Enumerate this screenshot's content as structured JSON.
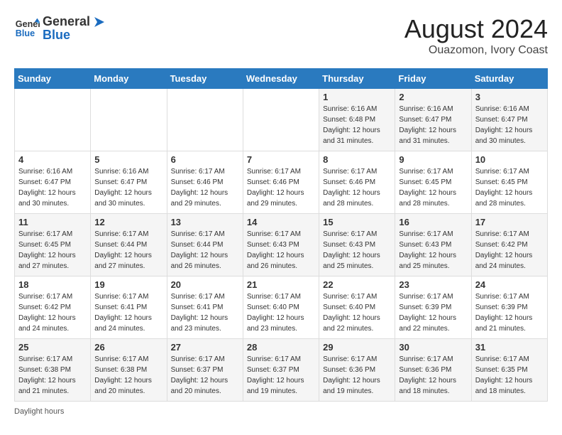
{
  "logo": {
    "line1": "General",
    "line2": "Blue"
  },
  "title": "August 2024",
  "location": "Ouazomon, Ivory Coast",
  "days_of_week": [
    "Sunday",
    "Monday",
    "Tuesday",
    "Wednesday",
    "Thursday",
    "Friday",
    "Saturday"
  ],
  "weeks": [
    [
      {
        "day": "",
        "info": ""
      },
      {
        "day": "",
        "info": ""
      },
      {
        "day": "",
        "info": ""
      },
      {
        "day": "",
        "info": ""
      },
      {
        "day": "1",
        "info": "Sunrise: 6:16 AM\nSunset: 6:48 PM\nDaylight: 12 hours\nand 31 minutes."
      },
      {
        "day": "2",
        "info": "Sunrise: 6:16 AM\nSunset: 6:47 PM\nDaylight: 12 hours\nand 31 minutes."
      },
      {
        "day": "3",
        "info": "Sunrise: 6:16 AM\nSunset: 6:47 PM\nDaylight: 12 hours\nand 30 minutes."
      }
    ],
    [
      {
        "day": "4",
        "info": "Sunrise: 6:16 AM\nSunset: 6:47 PM\nDaylight: 12 hours\nand 30 minutes."
      },
      {
        "day": "5",
        "info": "Sunrise: 6:16 AM\nSunset: 6:47 PM\nDaylight: 12 hours\nand 30 minutes."
      },
      {
        "day": "6",
        "info": "Sunrise: 6:17 AM\nSunset: 6:46 PM\nDaylight: 12 hours\nand 29 minutes."
      },
      {
        "day": "7",
        "info": "Sunrise: 6:17 AM\nSunset: 6:46 PM\nDaylight: 12 hours\nand 29 minutes."
      },
      {
        "day": "8",
        "info": "Sunrise: 6:17 AM\nSunset: 6:46 PM\nDaylight: 12 hours\nand 28 minutes."
      },
      {
        "day": "9",
        "info": "Sunrise: 6:17 AM\nSunset: 6:45 PM\nDaylight: 12 hours\nand 28 minutes."
      },
      {
        "day": "10",
        "info": "Sunrise: 6:17 AM\nSunset: 6:45 PM\nDaylight: 12 hours\nand 28 minutes."
      }
    ],
    [
      {
        "day": "11",
        "info": "Sunrise: 6:17 AM\nSunset: 6:45 PM\nDaylight: 12 hours\nand 27 minutes."
      },
      {
        "day": "12",
        "info": "Sunrise: 6:17 AM\nSunset: 6:44 PM\nDaylight: 12 hours\nand 27 minutes."
      },
      {
        "day": "13",
        "info": "Sunrise: 6:17 AM\nSunset: 6:44 PM\nDaylight: 12 hours\nand 26 minutes."
      },
      {
        "day": "14",
        "info": "Sunrise: 6:17 AM\nSunset: 6:43 PM\nDaylight: 12 hours\nand 26 minutes."
      },
      {
        "day": "15",
        "info": "Sunrise: 6:17 AM\nSunset: 6:43 PM\nDaylight: 12 hours\nand 25 minutes."
      },
      {
        "day": "16",
        "info": "Sunrise: 6:17 AM\nSunset: 6:43 PM\nDaylight: 12 hours\nand 25 minutes."
      },
      {
        "day": "17",
        "info": "Sunrise: 6:17 AM\nSunset: 6:42 PM\nDaylight: 12 hours\nand 24 minutes."
      }
    ],
    [
      {
        "day": "18",
        "info": "Sunrise: 6:17 AM\nSunset: 6:42 PM\nDaylight: 12 hours\nand 24 minutes."
      },
      {
        "day": "19",
        "info": "Sunrise: 6:17 AM\nSunset: 6:41 PM\nDaylight: 12 hours\nand 24 minutes."
      },
      {
        "day": "20",
        "info": "Sunrise: 6:17 AM\nSunset: 6:41 PM\nDaylight: 12 hours\nand 23 minutes."
      },
      {
        "day": "21",
        "info": "Sunrise: 6:17 AM\nSunset: 6:40 PM\nDaylight: 12 hours\nand 23 minutes."
      },
      {
        "day": "22",
        "info": "Sunrise: 6:17 AM\nSunset: 6:40 PM\nDaylight: 12 hours\nand 22 minutes."
      },
      {
        "day": "23",
        "info": "Sunrise: 6:17 AM\nSunset: 6:39 PM\nDaylight: 12 hours\nand 22 minutes."
      },
      {
        "day": "24",
        "info": "Sunrise: 6:17 AM\nSunset: 6:39 PM\nDaylight: 12 hours\nand 21 minutes."
      }
    ],
    [
      {
        "day": "25",
        "info": "Sunrise: 6:17 AM\nSunset: 6:38 PM\nDaylight: 12 hours\nand 21 minutes."
      },
      {
        "day": "26",
        "info": "Sunrise: 6:17 AM\nSunset: 6:38 PM\nDaylight: 12 hours\nand 20 minutes."
      },
      {
        "day": "27",
        "info": "Sunrise: 6:17 AM\nSunset: 6:37 PM\nDaylight: 12 hours\nand 20 minutes."
      },
      {
        "day": "28",
        "info": "Sunrise: 6:17 AM\nSunset: 6:37 PM\nDaylight: 12 hours\nand 19 minutes."
      },
      {
        "day": "29",
        "info": "Sunrise: 6:17 AM\nSunset: 6:36 PM\nDaylight: 12 hours\nand 19 minutes."
      },
      {
        "day": "30",
        "info": "Sunrise: 6:17 AM\nSunset: 6:36 PM\nDaylight: 12 hours\nand 18 minutes."
      },
      {
        "day": "31",
        "info": "Sunrise: 6:17 AM\nSunset: 6:35 PM\nDaylight: 12 hours\nand 18 minutes."
      }
    ]
  ],
  "footer": {
    "label": "Daylight hours"
  }
}
